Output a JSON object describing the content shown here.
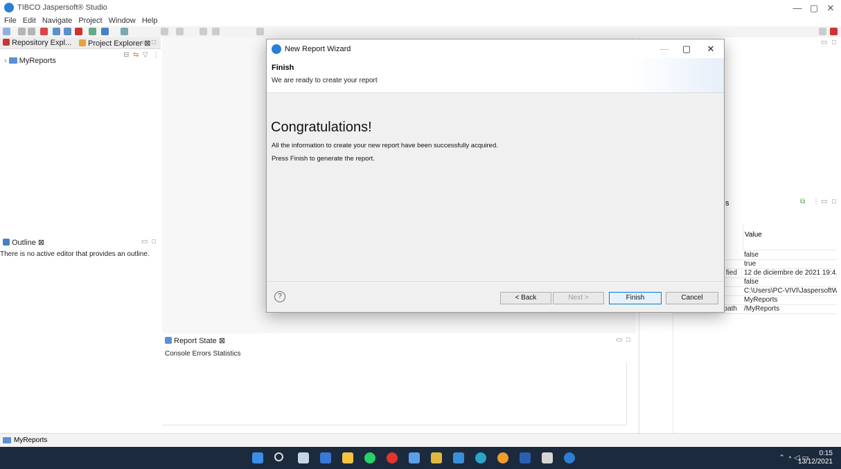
{
  "window": {
    "title": "TIBCO Jaspersoft® Studio",
    "minimize": "—",
    "maximize": "▢",
    "close": "✕"
  },
  "menu": [
    "File",
    "Edit",
    "Navigate",
    "Project",
    "Window",
    "Help"
  ],
  "left_panel": {
    "tabs": [
      {
        "label": "Repository Expl..."
      },
      {
        "label": "Project Explorer ⊠"
      }
    ],
    "tree": [
      {
        "label": "MyReports"
      }
    ]
  },
  "outline": {
    "tab": "Outline ⊠",
    "message": "There is no active editor that provides an outline."
  },
  "report_state": {
    "tab": "Report State ⊠",
    "subtabs": [
      "Console",
      "Errors",
      "Statistics"
    ]
  },
  "properties": {
    "partial_tab": "s",
    "column_header": "Value",
    "rows": [
      {
        "key": "",
        "value": "false"
      },
      {
        "key": "",
        "value": "true"
      },
      {
        "key": "fied",
        "value": "12 de diciembre de 2021 19:4..."
      },
      {
        "key": "",
        "value": "false"
      },
      {
        "key": "",
        "value": "C:\\Users\\PC-VIVI\\JaspersoftW..."
      },
      {
        "key": "",
        "value": "MyReports"
      },
      {
        "key": "path",
        "value": "/MyReports"
      }
    ]
  },
  "status_bar": {
    "text": "MyReports"
  },
  "dialog": {
    "title": "New Report Wizard",
    "header_title": "Finish",
    "header_desc": "We are ready to create your report",
    "heading": "Congratulations!",
    "line1": "All the information to create your new report have been successfully acquired.",
    "line2": "Press Finish to generate the report.",
    "buttons": {
      "back": "< Back",
      "next": "Next >",
      "finish": "Finish",
      "cancel": "Cancel"
    },
    "help": "?"
  },
  "clock": {
    "time": "0:15",
    "date": "13/12/2021"
  },
  "colors": {
    "taskbar": "#1c2a3e",
    "accent": "#0078d7",
    "dialog_body": "#f0f0f0"
  }
}
